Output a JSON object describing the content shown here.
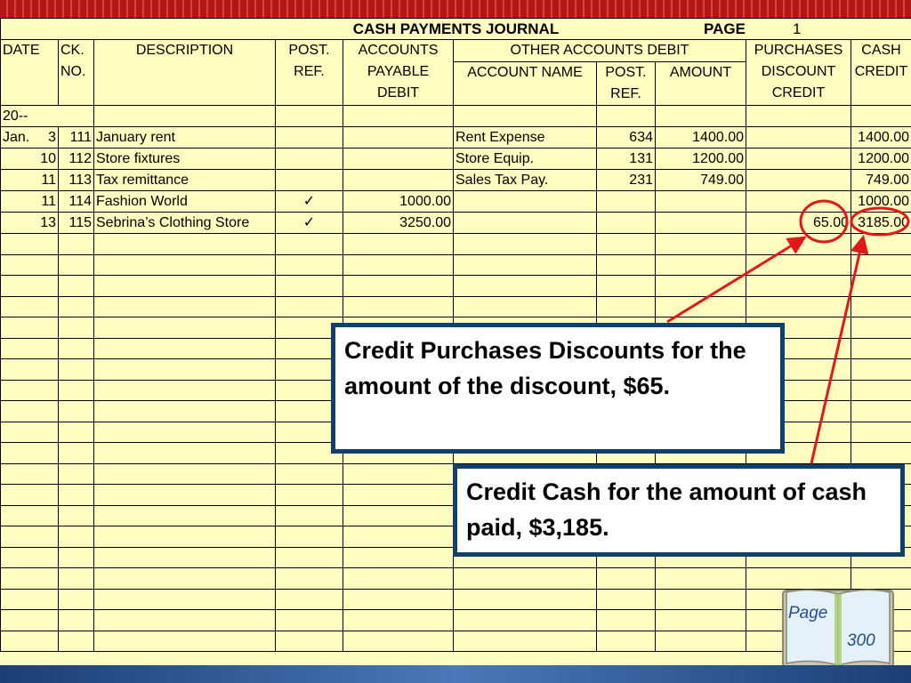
{
  "journal": {
    "title": "CASH PAYMENTS JOURNAL",
    "page_label": "PAGE",
    "page_number": "1",
    "headers": {
      "date": "DATE",
      "ck_1": "CK.",
      "ck_2": "NO.",
      "description": "DESCRIPTION",
      "post_1": "POST.",
      "post_2": "REF.",
      "ap_1": "ACCOUNTS",
      "ap_2": "PAYABLE",
      "ap_3": "DEBIT",
      "other": "OTHER ACCOUNTS DEBIT",
      "account_name": "ACCOUNT NAME",
      "other_post_1": "POST.",
      "other_post_2": "REF.",
      "amount": "AMOUNT",
      "pd_1": "PURCHASES",
      "pd_2": "DISCOUNT",
      "pd_3": "CREDIT",
      "cash_1": "CASH",
      "cash_2": "CREDIT"
    },
    "year_row": "20--",
    "rows": [
      {
        "month": "Jan.",
        "day": "3",
        "ck": "111",
        "description": "January rent",
        "post_ref": "",
        "ap_debit": "",
        "account_name": "Rent Expense",
        "other_post_ref": "634",
        "amount": "1400.00",
        "purchases_discount": "",
        "cash_credit": "1400.00"
      },
      {
        "month": "",
        "day": "10",
        "ck": "112",
        "description": "Store fixtures",
        "post_ref": "",
        "ap_debit": "",
        "account_name": "Store Equip.",
        "other_post_ref": "131",
        "amount": "1200.00",
        "purchases_discount": "",
        "cash_credit": "1200.00"
      },
      {
        "month": "",
        "day": "11",
        "ck": "113",
        "description": "Tax remittance",
        "post_ref": "",
        "ap_debit": "",
        "account_name": "Sales Tax Pay.",
        "other_post_ref": "231",
        "amount": "749.00",
        "purchases_discount": "",
        "cash_credit": "749.00"
      },
      {
        "month": "",
        "day": "11",
        "ck": "114",
        "description": "Fashion World",
        "post_ref": "✓",
        "ap_debit": "1000.00",
        "account_name": "",
        "other_post_ref": "",
        "amount": "",
        "purchases_discount": "",
        "cash_credit": "1000.00"
      },
      {
        "month": "",
        "day": "13",
        "ck": "115",
        "description": "Sebrina’s Clothing Store",
        "post_ref": "✓",
        "ap_debit": "3250.00",
        "account_name": "",
        "other_post_ref": "",
        "amount": "",
        "purchases_discount": "65.00",
        "cash_credit": "3185.00"
      }
    ]
  },
  "callouts": {
    "discount": "Credit Purchases Discounts for the  amount of  the discount, $65.",
    "cash": "Credit Cash for the amount of cash paid, $3,185."
  },
  "book": {
    "label": "Page",
    "number": "300"
  },
  "colors": {
    "paper": "#fffdc0",
    "callout_border": "#12406c",
    "highlight": "#e01818",
    "book_text": "#1d4f94"
  }
}
